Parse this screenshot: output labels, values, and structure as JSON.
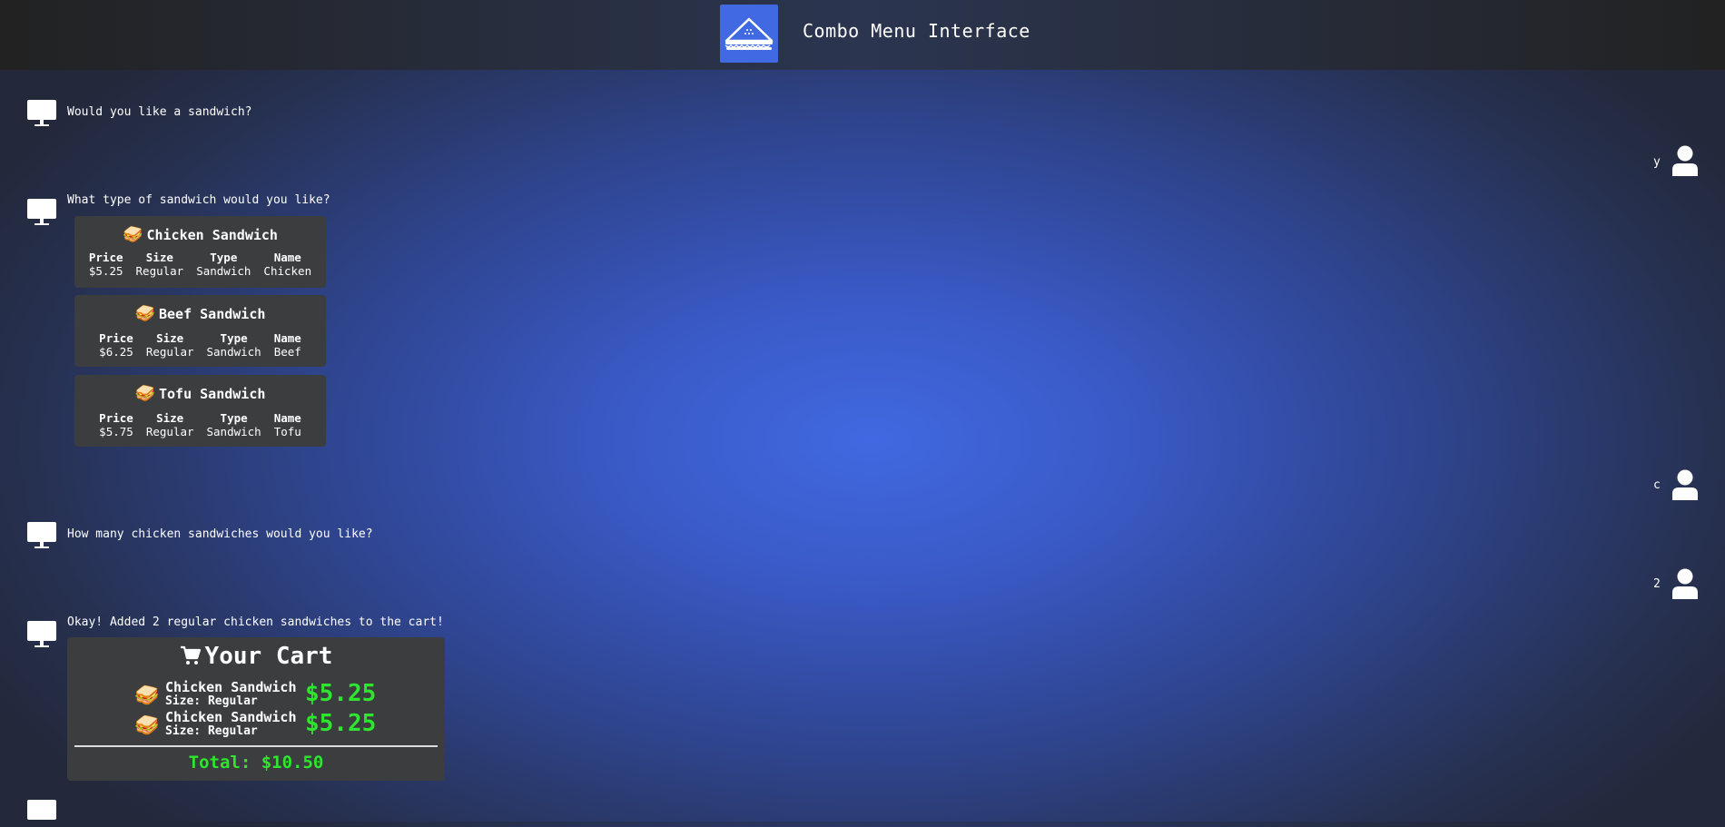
{
  "header": {
    "title": "Combo Menu Interface",
    "logo_icon": "sandwich-icon",
    "logo_bg": "#4169e1"
  },
  "conversation": {
    "q1": "Would you like a sandwich?",
    "a1": "y",
    "q2": "What type of sandwich would you like?",
    "a2": "c",
    "q3": "How many chicken sandwiches would you like?",
    "a3": "2",
    "q4": "Okay! Added 2 regular chicken sandwiches to the cart!"
  },
  "menu": {
    "headers": {
      "price": "Price",
      "size": "Size",
      "type": "Type",
      "name": "Name"
    },
    "items": [
      {
        "title": "Chicken Sandwich",
        "emoji": "🥪",
        "price": "$5.25",
        "size": "Regular",
        "type": "Sandwich",
        "name": "Chicken"
      },
      {
        "title": "Beef Sandwich",
        "emoji": "🥪",
        "price": "$6.25",
        "size": "Regular",
        "type": "Sandwich",
        "name": "Beef"
      },
      {
        "title": "Tofu Sandwich",
        "emoji": "🥪",
        "price": "$5.75",
        "size": "Regular",
        "type": "Sandwich",
        "name": "Tofu"
      }
    ]
  },
  "cart": {
    "title": "Your Cart",
    "icon": "cart-icon",
    "items": [
      {
        "emoji": "🥪",
        "name": "Chicken Sandwich",
        "size": "Size: Regular",
        "price": "$5.25"
      },
      {
        "emoji": "🥪",
        "name": "Chicken Sandwich",
        "size": "Size: Regular",
        "price": "$5.25"
      }
    ],
    "total": "Total: $10.50",
    "price_color": "#2ee62e"
  }
}
